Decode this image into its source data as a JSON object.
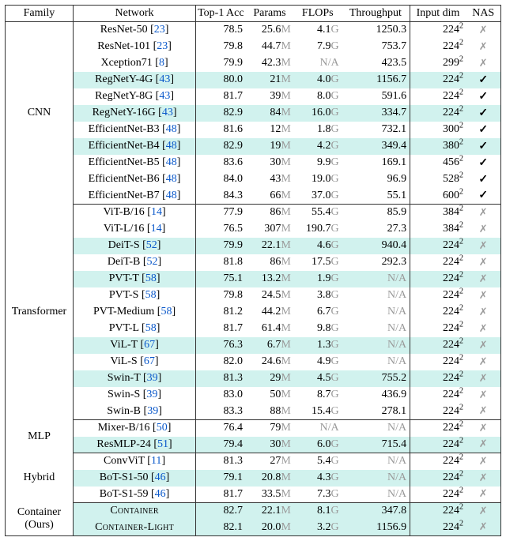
{
  "header": {
    "family": "Family",
    "network": "Network",
    "top1": "Top-1 Acc",
    "params": "Params",
    "flops": "FLOPs",
    "thr": "Throughput",
    "inp": "Input dim",
    "nas": "NAS"
  },
  "families": [
    {
      "name": "CNN",
      "rows": [
        {
          "net": "ResNet-50",
          "cite": "23",
          "top1": "78.5",
          "pnum": "25.6",
          "punit": "M",
          "fnum": "4.1",
          "funit": "G",
          "thr": "1250.3",
          "ibase": "224",
          "nas": false,
          "hl": false
        },
        {
          "net": "ResNet-101",
          "cite": "23",
          "top1": "79.8",
          "pnum": "44.7",
          "punit": "M",
          "fnum": "7.9",
          "funit": "G",
          "thr": "753.7",
          "ibase": "224",
          "nas": false,
          "hl": false
        },
        {
          "net": "Xception71",
          "cite": "8",
          "top1": "79.9",
          "pnum": "42.3",
          "punit": "M",
          "fnum": "",
          "funit": "",
          "fna": "N/A",
          "thr": "423.5",
          "ibase": "299",
          "nas": false,
          "hl": false
        },
        {
          "net": "RegNetY-4G",
          "cite": "43",
          "top1": "80.0",
          "pnum": "21",
          "punit": "M",
          "fnum": "4.0",
          "funit": "G",
          "thr": "1156.7",
          "ibase": "224",
          "nas": true,
          "hl": true
        },
        {
          "net": "RegNetY-8G",
          "cite": "43",
          "top1": "81.7",
          "pnum": "39",
          "punit": "M",
          "fnum": "8.0",
          "funit": "G",
          "thr": "591.6",
          "ibase": "224",
          "nas": true,
          "hl": false
        },
        {
          "net": "RegNetY-16G",
          "cite": "43",
          "top1": "82.9",
          "pnum": "84",
          "punit": "M",
          "fnum": "16.0",
          "funit": "G",
          "thr": "334.7",
          "ibase": "224",
          "nas": true,
          "hl": true
        },
        {
          "net": "EfficientNet-B3",
          "cite": "48",
          "top1": "81.6",
          "pnum": "12",
          "punit": "M",
          "fnum": "1.8",
          "funit": "G",
          "thr": "732.1",
          "ibase": "300",
          "nas": true,
          "hl": false
        },
        {
          "net": "EfficientNet-B4",
          "cite": "48",
          "top1": "82.9",
          "pnum": "19",
          "punit": "M",
          "fnum": "4.2",
          "funit": "G",
          "thr": "349.4",
          "ibase": "380",
          "nas": true,
          "hl": true
        },
        {
          "net": "EfficientNet-B5",
          "cite": "48",
          "top1": "83.6",
          "pnum": "30",
          "punit": "M",
          "fnum": "9.9",
          "funit": "G",
          "thr": "169.1",
          "ibase": "456",
          "nas": true,
          "hl": false
        },
        {
          "net": "EfficientNet-B6",
          "cite": "48",
          "top1": "84.0",
          "pnum": "43",
          "punit": "M",
          "fnum": "19.0",
          "funit": "G",
          "thr": "96.9",
          "ibase": "528",
          "nas": true,
          "hl": false
        },
        {
          "net": "EfficientNet-B7",
          "cite": "48",
          "top1": "84.3",
          "pnum": "66",
          "punit": "M",
          "fnum": "37.0",
          "funit": "G",
          "thr": "55.1",
          "ibase": "600",
          "nas": true,
          "hl": false
        }
      ]
    },
    {
      "name": "Transformer",
      "rows": [
        {
          "net": "ViT-B/16",
          "cite": "14",
          "top1": "77.9",
          "pnum": "86",
          "punit": "M",
          "fnum": "55.4",
          "funit": "G",
          "thr": "85.9",
          "ibase": "384",
          "nas": false,
          "hl": false
        },
        {
          "net": "ViT-L/16",
          "cite": "14",
          "top1": "76.5",
          "pnum": "307",
          "punit": "M",
          "fnum": "190.7",
          "funit": "G",
          "thr": "27.3",
          "ibase": "384",
          "nas": false,
          "hl": false
        },
        {
          "net": "DeiT-S",
          "cite": "52",
          "top1": "79.9",
          "pnum": "22.1",
          "punit": "M",
          "fnum": "4.6",
          "funit": "G",
          "thr": "940.4",
          "ibase": "224",
          "nas": false,
          "hl": true
        },
        {
          "net": "DeiT-B",
          "cite": "52",
          "top1": "81.8",
          "pnum": "86",
          "punit": "M",
          "fnum": "17.5",
          "funit": "G",
          "thr": "292.3",
          "ibase": "224",
          "nas": false,
          "hl": false
        },
        {
          "net": "PVT-T",
          "cite": "58",
          "top1": "75.1",
          "pnum": "13.2",
          "punit": "M",
          "fnum": "1.9",
          "funit": "G",
          "thr": "",
          "tna": "N/A",
          "ibase": "224",
          "nas": false,
          "hl": true
        },
        {
          "net": "PVT-S",
          "cite": "58",
          "top1": "79.8",
          "pnum": "24.5",
          "punit": "M",
          "fnum": "3.8",
          "funit": "G",
          "thr": "",
          "tna": "N/A",
          "ibase": "224",
          "nas": false,
          "hl": false
        },
        {
          "net": "PVT-Medium",
          "cite": "58",
          "top1": "81.2",
          "pnum": "44.2",
          "punit": "M",
          "fnum": "6.7",
          "funit": "G",
          "thr": "",
          "tna": "N/A",
          "ibase": "224",
          "nas": false,
          "hl": false
        },
        {
          "net": "PVT-L",
          "cite": "58",
          "top1": "81.7",
          "pnum": "61.4",
          "punit": "M",
          "fnum": "9.8",
          "funit": "G",
          "thr": "",
          "tna": "N/A",
          "ibase": "224",
          "nas": false,
          "hl": false
        },
        {
          "net": "ViL-T",
          "cite": "67",
          "top1": "76.3",
          "pnum": "6.7",
          "punit": "M",
          "fnum": "1.3",
          "funit": "G",
          "thr": "",
          "tna": "N/A",
          "ibase": "224",
          "nas": false,
          "hl": true
        },
        {
          "net": "ViL-S",
          "cite": "67",
          "top1": "82.0",
          "pnum": "24.6",
          "punit": "M",
          "fnum": "4.9",
          "funit": "G",
          "thr": "",
          "tna": "N/A",
          "ibase": "224",
          "nas": false,
          "hl": false
        },
        {
          "net": "Swin-T",
          "cite": "39",
          "top1": "81.3",
          "pnum": "29",
          "punit": "M",
          "fnum": "4.5",
          "funit": "G",
          "thr": "755.2",
          "ibase": "224",
          "nas": false,
          "hl": true
        },
        {
          "net": "Swin-S",
          "cite": "39",
          "top1": "83.0",
          "pnum": "50",
          "punit": "M",
          "fnum": "8.7",
          "funit": "G",
          "thr": "436.9",
          "ibase": "224",
          "nas": false,
          "hl": false
        },
        {
          "net": "Swin-B",
          "cite": "39",
          "top1": "83.3",
          "pnum": "88",
          "punit": "M",
          "fnum": "15.4",
          "funit": "G",
          "thr": "278.1",
          "ibase": "224",
          "nas": false,
          "hl": false
        }
      ]
    },
    {
      "name": "MLP",
      "rows": [
        {
          "net": "Mixer-B/16",
          "cite": "50",
          "top1": "76.4",
          "pnum": "79",
          "punit": "M",
          "fnum": "",
          "funit": "",
          "fna": "N/A",
          "thr": "",
          "tna": "N/A",
          "ibase": "224",
          "nas": false,
          "hl": false
        },
        {
          "net": "ResMLP-24",
          "cite": "51",
          "top1": "79.4",
          "pnum": "30",
          "punit": "M",
          "fnum": "6.0",
          "funit": "G",
          "thr": "715.4",
          "ibase": "224",
          "nas": false,
          "hl": true
        }
      ]
    },
    {
      "name": "Hybrid",
      "rows": [
        {
          "net": "ConvViT",
          "cite": "11",
          "top1": "81.3",
          "pnum": "27",
          "punit": "M",
          "fnum": "5.4",
          "funit": "G",
          "thr": "",
          "tna": "N/A",
          "ibase": "224",
          "nas": false,
          "hl": false
        },
        {
          "net": "BoT-S1-50",
          "cite": "46",
          "top1": "79.1",
          "pnum": "20.8",
          "punit": "M",
          "fnum": "4.3",
          "funit": "G",
          "thr": "",
          "tna": "N/A",
          "ibase": "224",
          "nas": false,
          "hl": true
        },
        {
          "net": "BoT-S1-59",
          "cite": "46",
          "top1": "81.7",
          "pnum": "33.5",
          "punit": "M",
          "fnum": "7.3",
          "funit": "G",
          "thr": "",
          "tna": "N/A",
          "ibase": "224",
          "nas": false,
          "hl": false
        }
      ]
    },
    {
      "name": "Container",
      "sub": "(Ours)",
      "rows": [
        {
          "netSC": "Container",
          "top1": "82.7",
          "pnum": "22.1",
          "punit": "M",
          "fnum": "8.1",
          "funit": "G",
          "thr": "347.8",
          "ibase": "224",
          "nas": false,
          "hl": true
        },
        {
          "netSC": "Container-Light",
          "top1": "82.1",
          "pnum": "20.0",
          "punit": "M",
          "fnum": "3.2",
          "funit": "G",
          "thr": "1156.9",
          "ibase": "224",
          "nas": false,
          "hl": true
        }
      ]
    }
  ]
}
